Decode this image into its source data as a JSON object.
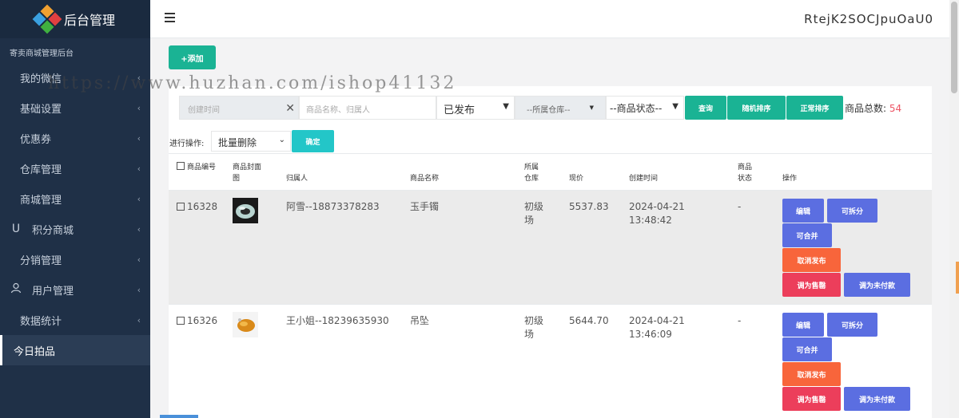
{
  "sidebar": {
    "logo_title": "后台管理",
    "subtitle": "寄卖商城管理后台",
    "items": [
      {
        "label": "我的微信",
        "icon": ""
      },
      {
        "label": "基础设置",
        "icon": ""
      },
      {
        "label": "优惠券",
        "icon": ""
      },
      {
        "label": "仓库管理",
        "icon": ""
      },
      {
        "label": "商城管理",
        "icon": ""
      },
      {
        "label": "积分商城",
        "icon": "magnet-icon"
      },
      {
        "label": "分销管理",
        "icon": ""
      },
      {
        "label": "用户管理",
        "icon": "user-icon"
      },
      {
        "label": "数据统计",
        "icon": ""
      },
      {
        "label": "今日拍品",
        "icon": "",
        "active": true
      }
    ],
    "bg_color": "#1f3047"
  },
  "topbar": {
    "username": "RtejK2SOCJpuOaU0"
  },
  "watermark": "https://www.huzhan.com/ishop41132",
  "toolbar": {
    "add_label": "+添加",
    "date_placeholder": "创建时间",
    "keyword_placeholder": "商品名称、归属人",
    "publish_select": "已发布",
    "warehouse_select": "--所属仓库--",
    "status_select": "--商品状态--",
    "query_label": "查询",
    "random_sort_label": "随机排序",
    "normal_sort_label": "正常排序",
    "total_label": "商品总数:",
    "total_count": "54",
    "batch_label": "进行操作:",
    "batch_select": "批量删除",
    "confirm_label": "确定"
  },
  "table": {
    "headers": {
      "id": "商品编号",
      "cover": "商品封面图",
      "owner": "归属人",
      "name": "商品名称",
      "warehouse": "所属仓库",
      "price": "现价",
      "created": "创建时间",
      "status": "商品状态",
      "ops": "操作"
    },
    "rows": [
      {
        "id": "16328",
        "owner": "阿雪--18873378283",
        "name": "玉手镯",
        "warehouse": "初级场",
        "price": "5537.83",
        "created_date": "2024-04-21",
        "created_time": "13:48:42",
        "status": "-"
      },
      {
        "id": "16326",
        "owner": "王小姐--18239635930",
        "name": "吊坠",
        "warehouse": "初级场",
        "price": "5644.70",
        "created_date": "2024-04-21",
        "created_time": "13:46:09",
        "status": "-"
      }
    ],
    "actions": {
      "edit": "编辑",
      "split": "可拆分",
      "merge": "可合并",
      "unpublish": "取消发布",
      "sold": "调为售罄",
      "unpaid": "调为未付款"
    }
  },
  "colors": {
    "green": "#1ab394",
    "cyan": "#23c6c8",
    "blue": "#5b6ee1",
    "orange": "#f8653b",
    "red": "#ec3e5b",
    "count": "#ed5565"
  }
}
